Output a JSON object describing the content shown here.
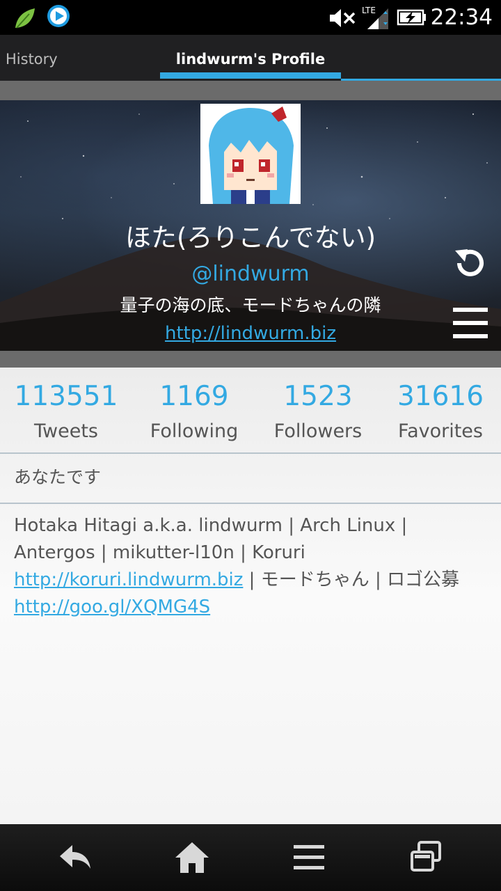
{
  "status_bar": {
    "time": "22:34",
    "network": "LTE"
  },
  "tabs": {
    "history": "History",
    "profile": "lindwurm's Profile"
  },
  "profile": {
    "display_name": "ほた(ろりこんでない)",
    "screen_name": "@lindwurm",
    "location": "量子の海の底、モードちゃんの隣",
    "url": "http://lindwurm.biz"
  },
  "stats": [
    {
      "value": "113551",
      "label": "Tweets"
    },
    {
      "value": "1169",
      "label": "Following"
    },
    {
      "value": "1523",
      "label": "Followers"
    },
    {
      "value": "31616",
      "label": "Favorites"
    }
  ],
  "relation": "あなたです",
  "bio": {
    "text1": "Hotaka Hitagi a.k.a. lindwurm | Arch Linux | Antergos | mikutter-l10n | Koruri ",
    "link1": "http://koruri.lindwurm.biz",
    "text2": " | モードちゃん | ロゴ公募 ",
    "link2": "http://goo.gl/XQMG4S"
  },
  "colors": {
    "accent": "#33a9e2",
    "tab_bar": "#202022",
    "text": "#555555"
  }
}
